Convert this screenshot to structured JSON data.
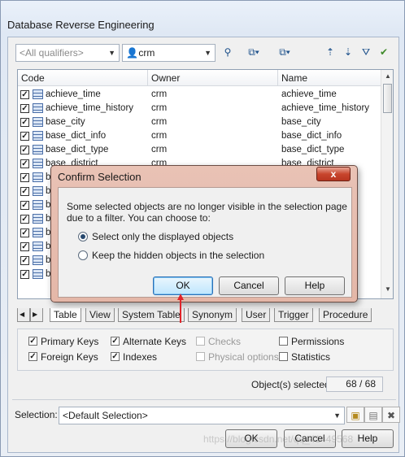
{
  "window": {
    "title": "Database Reverse Engineering"
  },
  "toolbar": {
    "qualifier_placeholder": "<All qualifiers>",
    "owner_value": "crm",
    "icons": [
      "find-owner-icon",
      "select-all-icon",
      "deselect-all-icon",
      "move-up-icon",
      "move-down-icon",
      "filter-icon",
      "check-all-icon"
    ]
  },
  "list": {
    "columns": [
      "Code",
      "Owner",
      "Name"
    ],
    "rows": [
      {
        "code": "achieve_time",
        "owner": "crm",
        "name": "achieve_time"
      },
      {
        "code": "achieve_time_history",
        "owner": "crm",
        "name": "achieve_time_history"
      },
      {
        "code": "base_city",
        "owner": "crm",
        "name": "base_city"
      },
      {
        "code": "base_dict_info",
        "owner": "crm",
        "name": "base_dict_info"
      },
      {
        "code": "base_dict_type",
        "owner": "crm",
        "name": "base_dict_type"
      },
      {
        "code": "base_district",
        "owner": "crm",
        "name": "base_district"
      },
      {
        "code": "ba",
        "owner": "",
        "name": ""
      },
      {
        "code": "ba",
        "owner": "",
        "name": ""
      },
      {
        "code": "ba",
        "owner": "",
        "name": ""
      },
      {
        "code": "ba",
        "owner": "",
        "name": ""
      },
      {
        "code": "ba",
        "owner": "",
        "name": ""
      },
      {
        "code": "ba",
        "owner": "",
        "name": ""
      },
      {
        "code": "ba",
        "owner": "",
        "name": ""
      },
      {
        "code": "bi",
        "owner": "",
        "name": "onth_p"
      }
    ]
  },
  "tabs": [
    "Table",
    "View",
    "System Table",
    "Synonym",
    "User",
    "Trigger",
    "Procedure"
  ],
  "options": {
    "primary_keys": "Primary Keys",
    "alternate_keys": "Alternate Keys",
    "checks": "Checks",
    "permissions": "Permissions",
    "foreign_keys": "Foreign Keys",
    "indexes": "Indexes",
    "physical_options": "Physical options",
    "statistics": "Statistics"
  },
  "status": {
    "label": "Object(s) selected:",
    "value": "68 / 68"
  },
  "selection": {
    "label": "Selection:",
    "value": "<Default Selection>"
  },
  "buttons": {
    "ok": "OK",
    "cancel": "Cancel",
    "help": "Help"
  },
  "dialog": {
    "title": "Confirm Selection",
    "close": "x",
    "message_line1": "Some selected objects are no longer visible in the selection page",
    "message_line2": "due to a filter. You can choose to:",
    "option1": "Select only the displayed objects",
    "option2": "Keep the hidden objects in the selection",
    "ok": "OK",
    "cancel": "Cancel",
    "help": "Help"
  },
  "watermark": "https://blog.csdn.net/qq_41449568",
  "colors": {
    "dialog_frame": "#e6bcae",
    "close_button": "#c8452d",
    "annotation_arrow": "#e0242a"
  }
}
